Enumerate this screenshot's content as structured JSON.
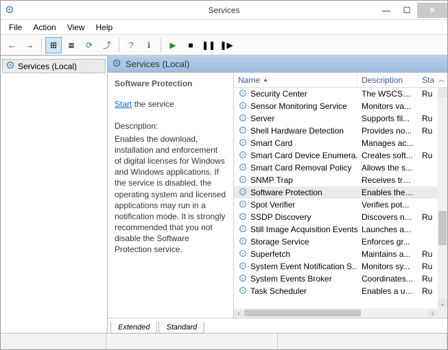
{
  "window": {
    "title": "Services",
    "min": "—",
    "max": "☐",
    "close": "✕"
  },
  "menu": {
    "file": "File",
    "action": "Action",
    "view": "View",
    "help": "Help"
  },
  "toolbar": {
    "back": "←",
    "forward": "→",
    "show_hide": "⊞",
    "props": "≣",
    "refresh": "⟳",
    "export": "⤴",
    "help_q": "?",
    "help_i": "ℹ",
    "start": "▶",
    "stop": "■",
    "pause": "❚❚",
    "restart": "❚▶"
  },
  "tree": {
    "root": "Services (Local)"
  },
  "header": {
    "title": "Services (Local)"
  },
  "details": {
    "name": "Software Protection",
    "start_link": "Start",
    "start_suffix": " the service",
    "desc_label": "Description:",
    "desc_body": "Enables the download, installation and enforcement of digital licenses for Windows and Windows applications. If the service is disabled, the operating system and licensed applications may run in a notification mode. It is strongly recommended that you not disable the Software Protection service."
  },
  "columns": {
    "name": "Name",
    "desc": "Description",
    "sta": "Sta"
  },
  "services": [
    {
      "name": "Security Center",
      "desc": "The WSCSV...",
      "sta": "Ru",
      "selected": false
    },
    {
      "name": "Sensor Monitoring Service",
      "desc": "Monitors va...",
      "sta": "",
      "selected": false
    },
    {
      "name": "Server",
      "desc": "Supports fil...",
      "sta": "Ru",
      "selected": false
    },
    {
      "name": "Shell Hardware Detection",
      "desc": "Provides no...",
      "sta": "Ru",
      "selected": false
    },
    {
      "name": "Smart Card",
      "desc": "Manages ac...",
      "sta": "",
      "selected": false
    },
    {
      "name": "Smart Card Device Enumera...",
      "desc": "Creates soft...",
      "sta": "Ru",
      "selected": false
    },
    {
      "name": "Smart Card Removal Policy",
      "desc": "Allows the s...",
      "sta": "",
      "selected": false
    },
    {
      "name": "SNMP Trap",
      "desc": "Receives tra...",
      "sta": "",
      "selected": false
    },
    {
      "name": "Software Protection",
      "desc": "Enables the ...",
      "sta": "",
      "selected": true
    },
    {
      "name": "Spot Verifier",
      "desc": "Verifies pot...",
      "sta": "",
      "selected": false
    },
    {
      "name": "SSDP Discovery",
      "desc": "Discovers n...",
      "sta": "Ru",
      "selected": false
    },
    {
      "name": "Still Image Acquisition Events",
      "desc": "Launches a...",
      "sta": "",
      "selected": false
    },
    {
      "name": "Storage Service",
      "desc": "Enforces gr...",
      "sta": "",
      "selected": false
    },
    {
      "name": "Superfetch",
      "desc": "Maintains a...",
      "sta": "Ru",
      "selected": false
    },
    {
      "name": "System Event Notification S...",
      "desc": "Monitors sy...",
      "sta": "Ru",
      "selected": false
    },
    {
      "name": "System Events Broker",
      "desc": "Coordinates...",
      "sta": "Ru",
      "selected": false
    },
    {
      "name": "Task Scheduler",
      "desc": "Enables a us...",
      "sta": "Ru",
      "selected": false
    }
  ],
  "tabs": {
    "extended": "Extended",
    "standard": "Standard"
  },
  "icons": {
    "gear_color": "#5a90c8"
  }
}
